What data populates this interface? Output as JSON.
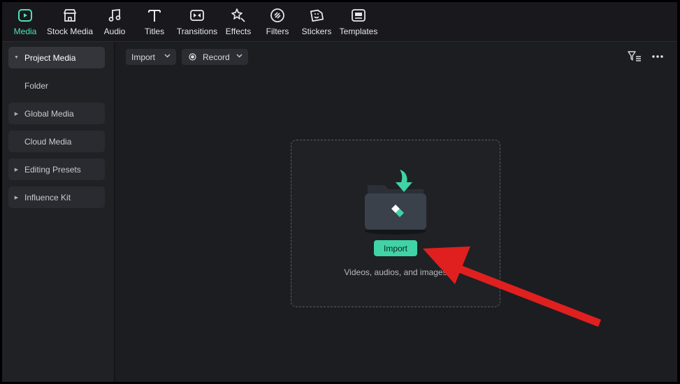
{
  "toolbar": {
    "tabs": [
      {
        "label": "Media",
        "icon": "media-icon",
        "active": true
      },
      {
        "label": "Stock Media",
        "icon": "stock-media-icon"
      },
      {
        "label": "Audio",
        "icon": "audio-icon"
      },
      {
        "label": "Titles",
        "icon": "titles-icon"
      },
      {
        "label": "Transitions",
        "icon": "transitions-icon"
      },
      {
        "label": "Effects",
        "icon": "effects-icon"
      },
      {
        "label": "Filters",
        "icon": "filters-icon"
      },
      {
        "label": "Stickers",
        "icon": "stickers-icon"
      },
      {
        "label": "Templates",
        "icon": "templates-icon"
      }
    ]
  },
  "sidebar": {
    "items": [
      {
        "label": "Project Media",
        "expandable": true,
        "active": true
      },
      {
        "label": "Folder",
        "expandable": false
      },
      {
        "label": "Global Media",
        "expandable": true
      },
      {
        "label": "Cloud Media",
        "expandable": false
      },
      {
        "label": "Editing Presets",
        "expandable": true
      },
      {
        "label": "Influence Kit",
        "expandable": true
      }
    ]
  },
  "main": {
    "import_dropdown": "Import",
    "record_dropdown": "Record",
    "dropzone": {
      "button_label": "Import",
      "hint": "Videos, audios, and images"
    }
  },
  "colors": {
    "accent": "#4fe0b6",
    "import_button": "#3fd3a6",
    "annotation_arrow": "#e0201f"
  }
}
